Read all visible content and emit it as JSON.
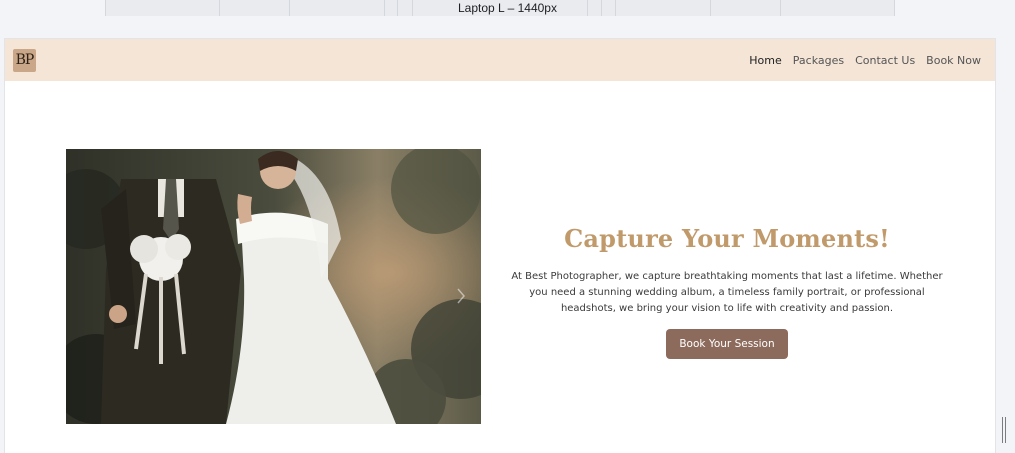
{
  "devtools": {
    "ruler_label": "Laptop L – 1440px"
  },
  "site": {
    "logo_text": "BP",
    "nav": [
      {
        "label": "Home",
        "active": true
      },
      {
        "label": "Packages",
        "active": false
      },
      {
        "label": "Contact Us",
        "active": false
      },
      {
        "label": "Book Now",
        "active": false
      }
    ]
  },
  "hero": {
    "title": "Capture Your Moments!",
    "description": "At Best Photographer, we capture breathtaking moments that last a lifetime. Whether you need a stunning wedding album, a timeless family portrait, or professional headshots, we bring your vision to life with creativity and passion.",
    "button_label": "Book Your Session",
    "image_subject": "bride-and-groom-photo"
  },
  "colors": {
    "navbar_bg": "#f4e5d7",
    "title": "#c19a6b",
    "button_bg": "#8c6b5d"
  }
}
